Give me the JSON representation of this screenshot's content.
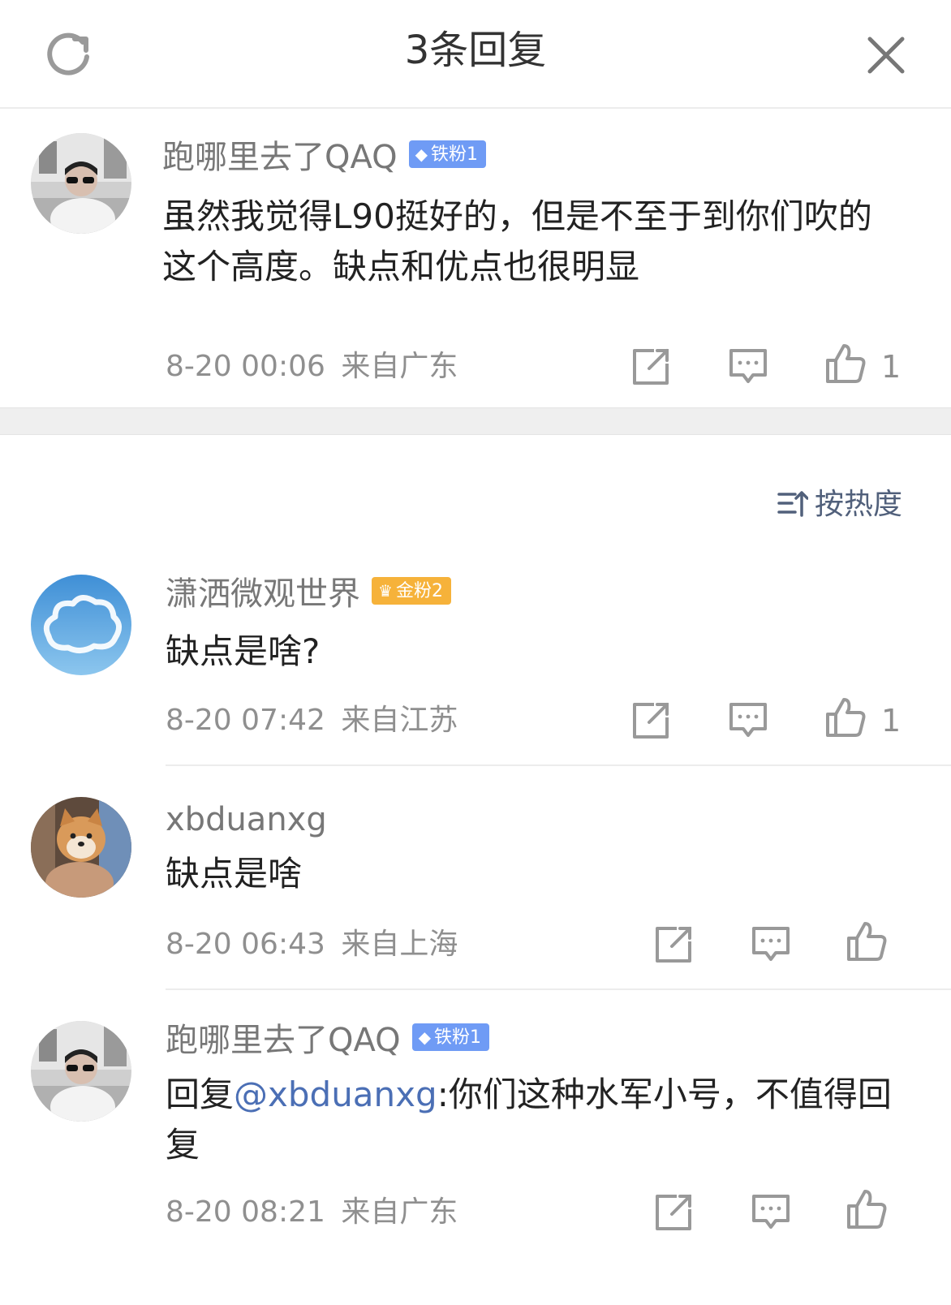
{
  "header": {
    "title": "3条回复",
    "refresh_icon": "refresh-icon",
    "close_icon": "close-icon"
  },
  "main_comment": {
    "user": "跑哪里去了QAQ",
    "badge": "铁粉1",
    "text": "虽然我觉得L90挺好的，但是不至于到你们吹的这个高度。缺点和优点也很明显",
    "time": "8-20 00:06",
    "location": "来自广东",
    "likes": "1"
  },
  "sort": {
    "label": "按热度"
  },
  "replies": [
    {
      "user": "潇洒微观世界",
      "badge": "金粉2",
      "text": "缺点是啥?",
      "time": "8-20 07:42",
      "location": "来自江苏",
      "likes": "1"
    },
    {
      "user": "xbduanxg",
      "text": "缺点是啥",
      "time": "8-20 06:43",
      "location": "来自上海"
    },
    {
      "user": "跑哪里去了QAQ",
      "badge": "铁粉1",
      "reply_prefix": "回复",
      "mention": "@xbduanxg",
      "text": ":你们这种水军小号，不值得回复",
      "time": "8-20 08:21",
      "location": "来自广东"
    }
  ],
  "colors": {
    "badge_iron": "#6f9bf5",
    "badge_gold": "#f6b23a",
    "mention": "#4b6fb5",
    "meta": "#8f8f8f"
  }
}
